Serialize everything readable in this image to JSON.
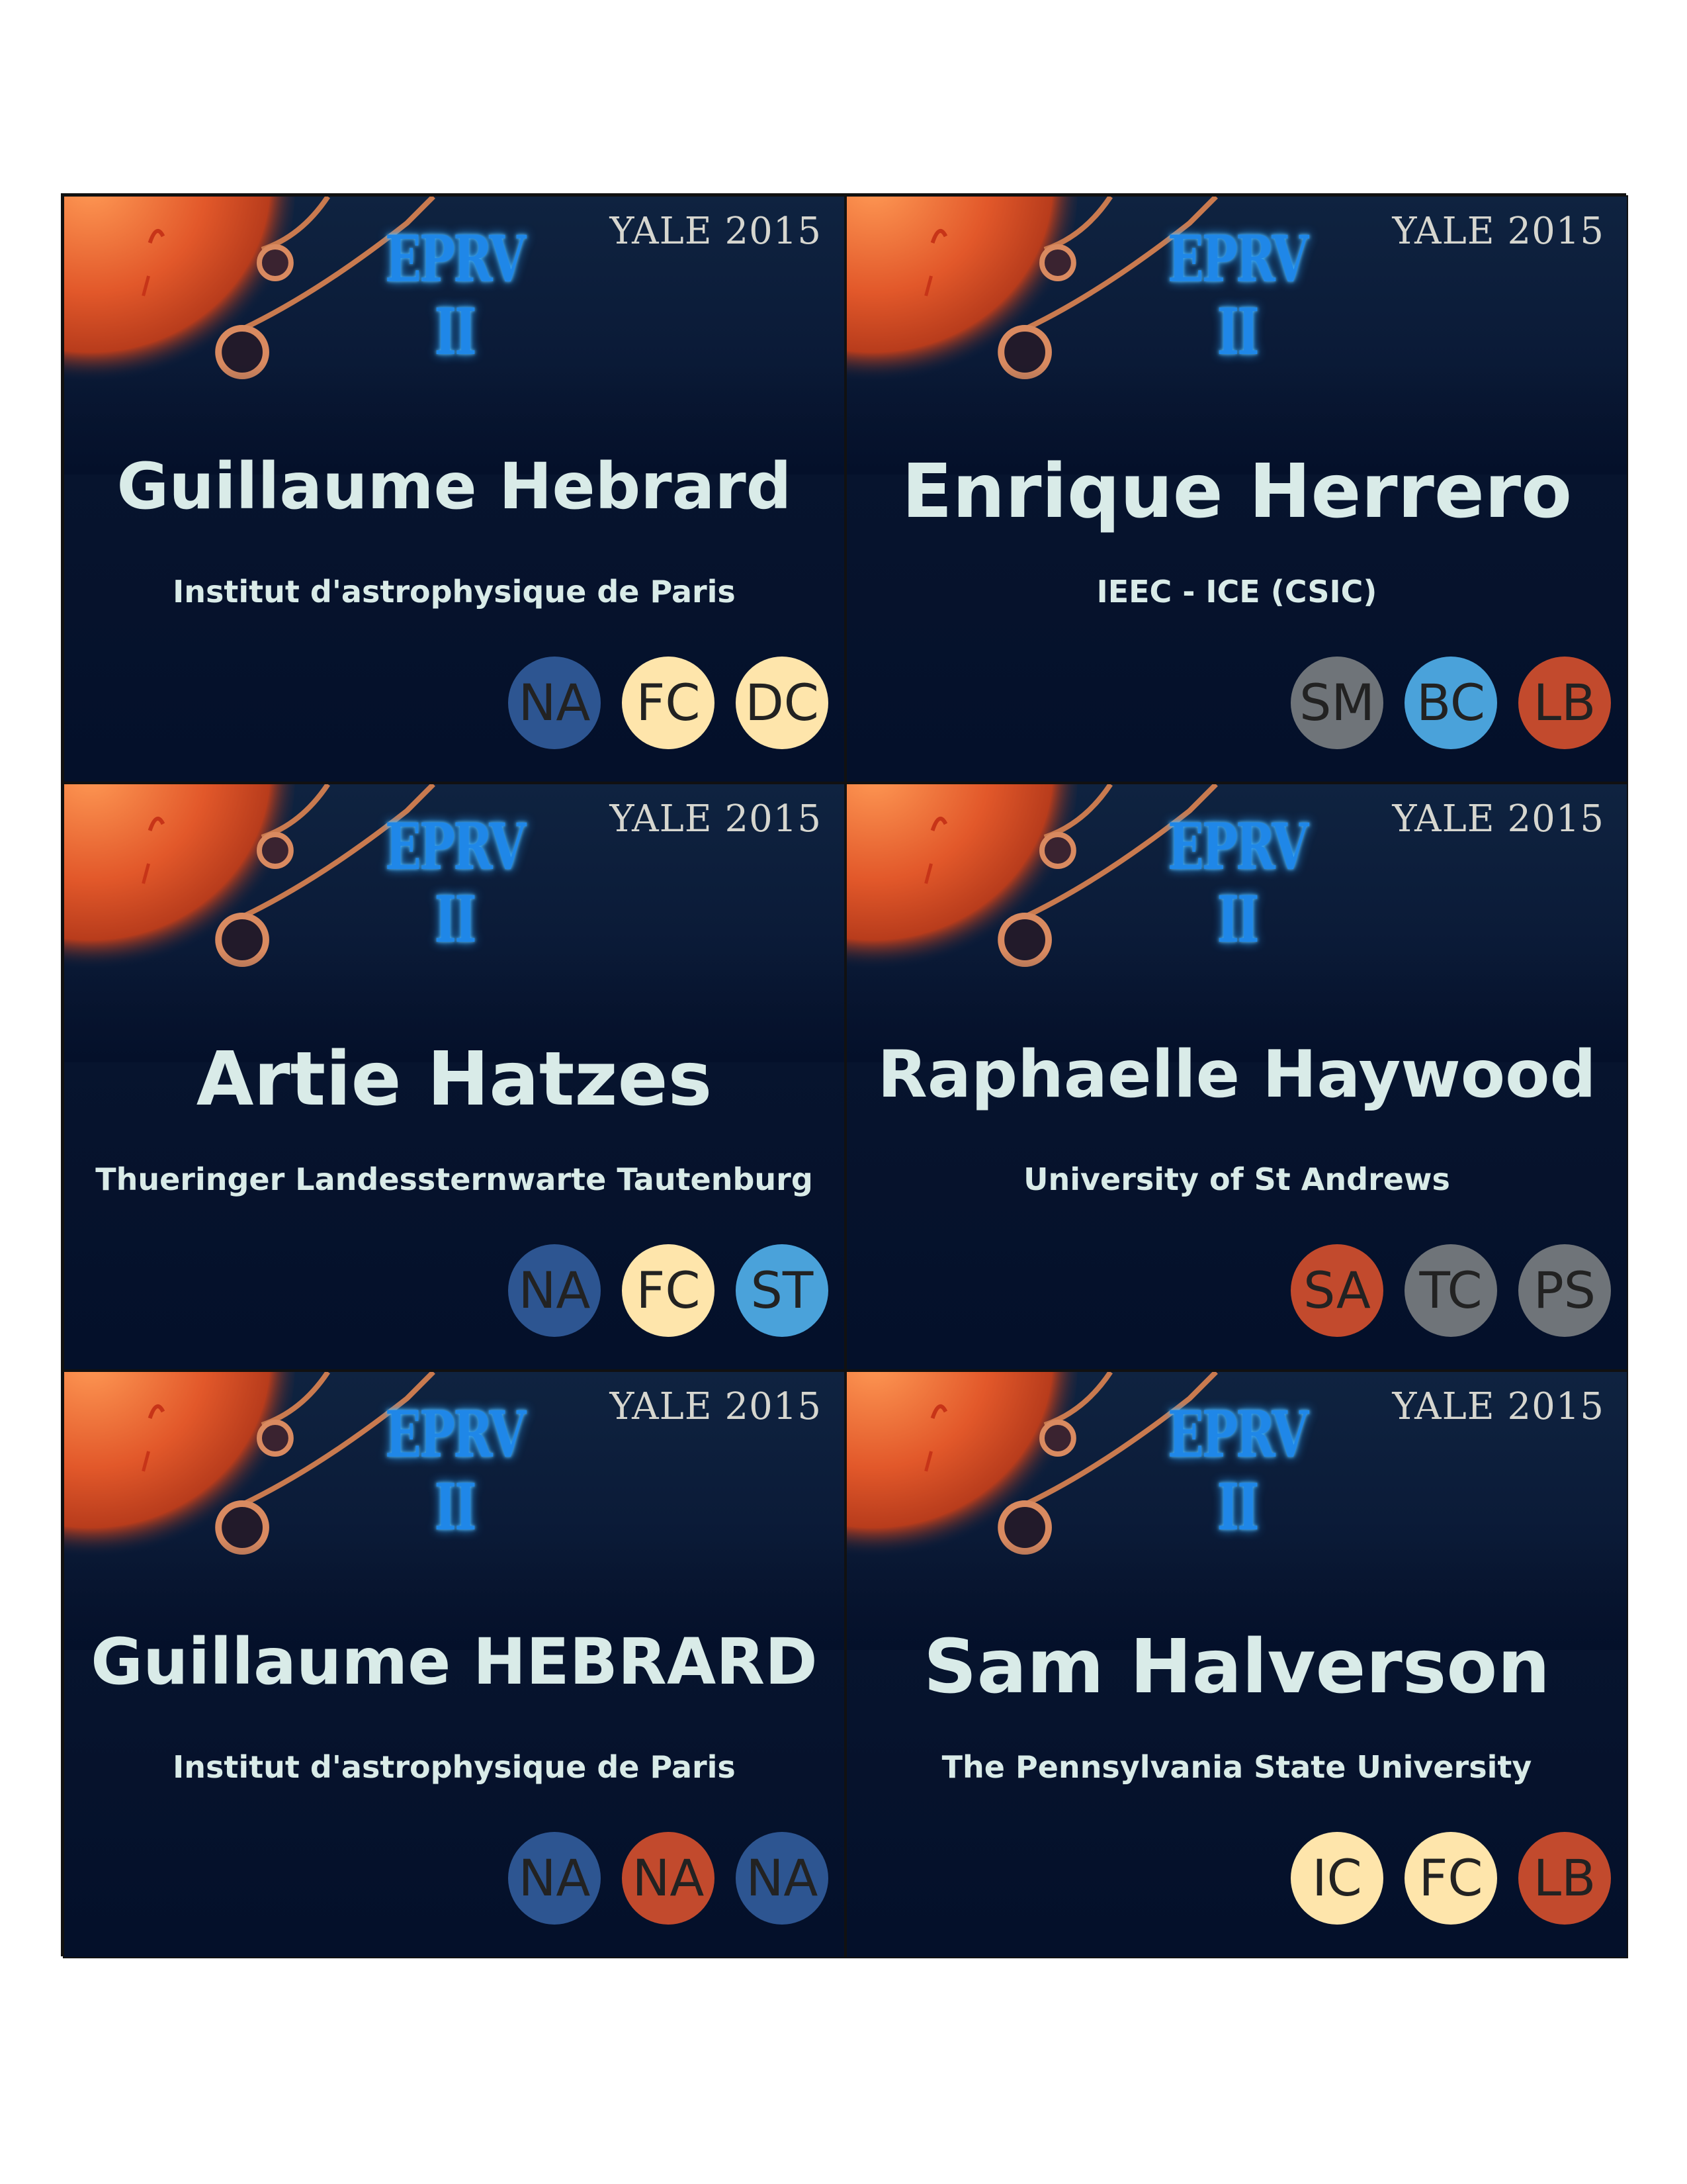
{
  "event": {
    "title": "EPRV II",
    "year": "YALE 2015"
  },
  "colors": {
    "navy": "#2d5591",
    "cream": "#fee5ab",
    "sky": "#4aa2da",
    "rust": "#c24a2d",
    "gray": "#6f7479"
  },
  "badges": [
    {
      "name": "Guillaume Hebrard",
      "affiliation": "Institut d'astrophysique de Paris",
      "name_size": 96,
      "chips": [
        {
          "label": "NA",
          "color": "#2d5591"
        },
        {
          "label": "FC",
          "color": "#fee5ab"
        },
        {
          "label": "DC",
          "color": "#fee5ab"
        }
      ]
    },
    {
      "name": "Enrique Herrero",
      "affiliation": "IEEC - ICE (CSIC)",
      "name_size": 112,
      "chips": [
        {
          "label": "SM",
          "color": "#6f7479"
        },
        {
          "label": "BC",
          "color": "#4aa2da"
        },
        {
          "label": "LB",
          "color": "#c24a2d"
        }
      ]
    },
    {
      "name": "Artie Hatzes",
      "affiliation": "Thueringer Landessternwarte Tautenburg",
      "name_size": 112,
      "chips": [
        {
          "label": "NA",
          "color": "#2d5591"
        },
        {
          "label": "FC",
          "color": "#fee5ab"
        },
        {
          "label": "ST",
          "color": "#4aa2da"
        }
      ]
    },
    {
      "name": "Raphaelle Haywood",
      "affiliation": "University of St Andrews",
      "name_size": 98,
      "chips": [
        {
          "label": "SA",
          "color": "#c24a2d"
        },
        {
          "label": "TC",
          "color": "#6f7479"
        },
        {
          "label": "PS",
          "color": "#6f7479"
        }
      ]
    },
    {
      "name": "Guillaume HEBRARD",
      "affiliation": "Institut d'astrophysique de Paris",
      "name_size": 96,
      "chips": [
        {
          "label": "NA",
          "color": "#2d5591"
        },
        {
          "label": "NA",
          "color": "#c24a2d"
        },
        {
          "label": "NA",
          "color": "#2d5591"
        }
      ]
    },
    {
      "name": "Sam Halverson",
      "affiliation": "The Pennsylvania State University",
      "name_size": 112,
      "chips": [
        {
          "label": "IC",
          "color": "#fee5ab"
        },
        {
          "label": "FC",
          "color": "#fee5ab"
        },
        {
          "label": "LB",
          "color": "#c24a2d"
        }
      ]
    }
  ]
}
